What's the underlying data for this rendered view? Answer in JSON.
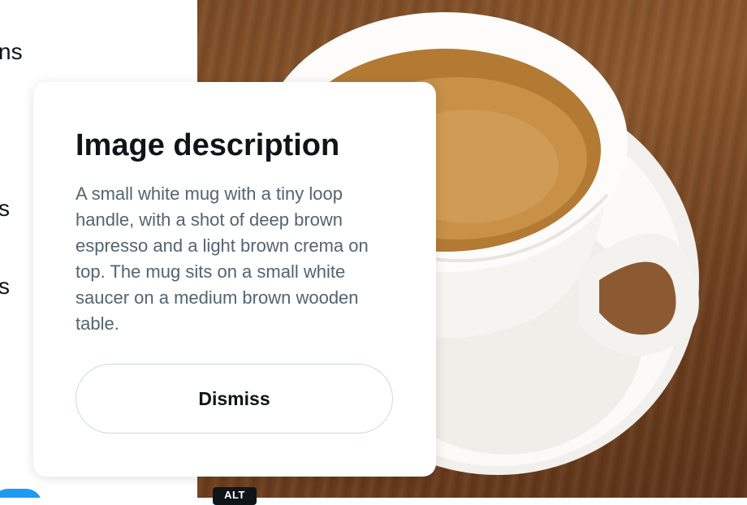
{
  "sidebar": {
    "items": [
      {
        "label": "ns"
      },
      {
        "label": "s"
      },
      {
        "label": "s"
      }
    ]
  },
  "photo": {
    "alt_badge": "ALT"
  },
  "modal": {
    "title": "Image description",
    "description": "A small white mug with a tiny loop handle, with a shot of deep brown espresso and a light brown crema on top. The mug sits on a small white saucer on a medium brown wooden table.",
    "dismiss_label": "Dismiss"
  },
  "colors": {
    "text_primary": "#0f1419",
    "text_secondary": "#536471",
    "accent": "#1d9bf0",
    "border": "#cfd9de"
  }
}
